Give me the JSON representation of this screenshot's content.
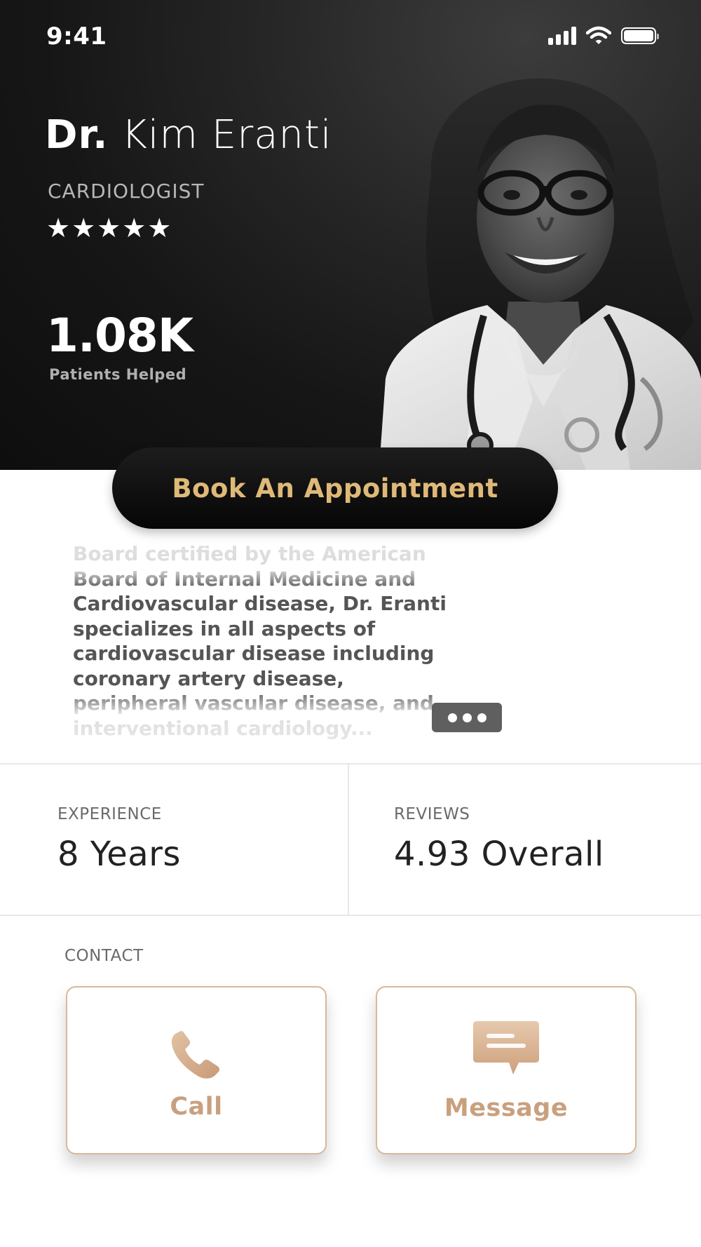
{
  "status_bar": {
    "time": "9:41"
  },
  "doctor": {
    "title_prefix": "Dr.",
    "name": "Kim Eranti",
    "specialty": "CARDIOLOGIST",
    "rating_stars": 5,
    "stars_glyphs": "★★★★★",
    "patients_value": "1.08K",
    "patients_label": "Patients Helped"
  },
  "cta": {
    "label": "Book An Appointment"
  },
  "bio": {
    "text": "Board certified by the American Board of Internal Medicine and Cardiovascular disease, Dr. Eranti specializes in all aspects of cardiovascular disease including coronary artery disease, peripheral vascular disease, and interventional cardiology..."
  },
  "stats": {
    "experience": {
      "label": "EXPERIENCE",
      "value": "8 Years"
    },
    "reviews": {
      "label": "REVIEWS",
      "value": "4.93 Overall"
    }
  },
  "contact": {
    "label": "CONTACT",
    "call_label": "Call",
    "message_label": "Message"
  },
  "colors": {
    "accent_gold": "#dfb978",
    "accent_tan": "#c9a07e",
    "hero_dark": "#161616",
    "card_border": "#d8b89a"
  },
  "icons": {
    "call": "phone-icon",
    "message": "message-icon",
    "more": "more-dots-icon",
    "signal": "signal-icon",
    "wifi": "wifi-icon",
    "battery": "battery-icon"
  }
}
